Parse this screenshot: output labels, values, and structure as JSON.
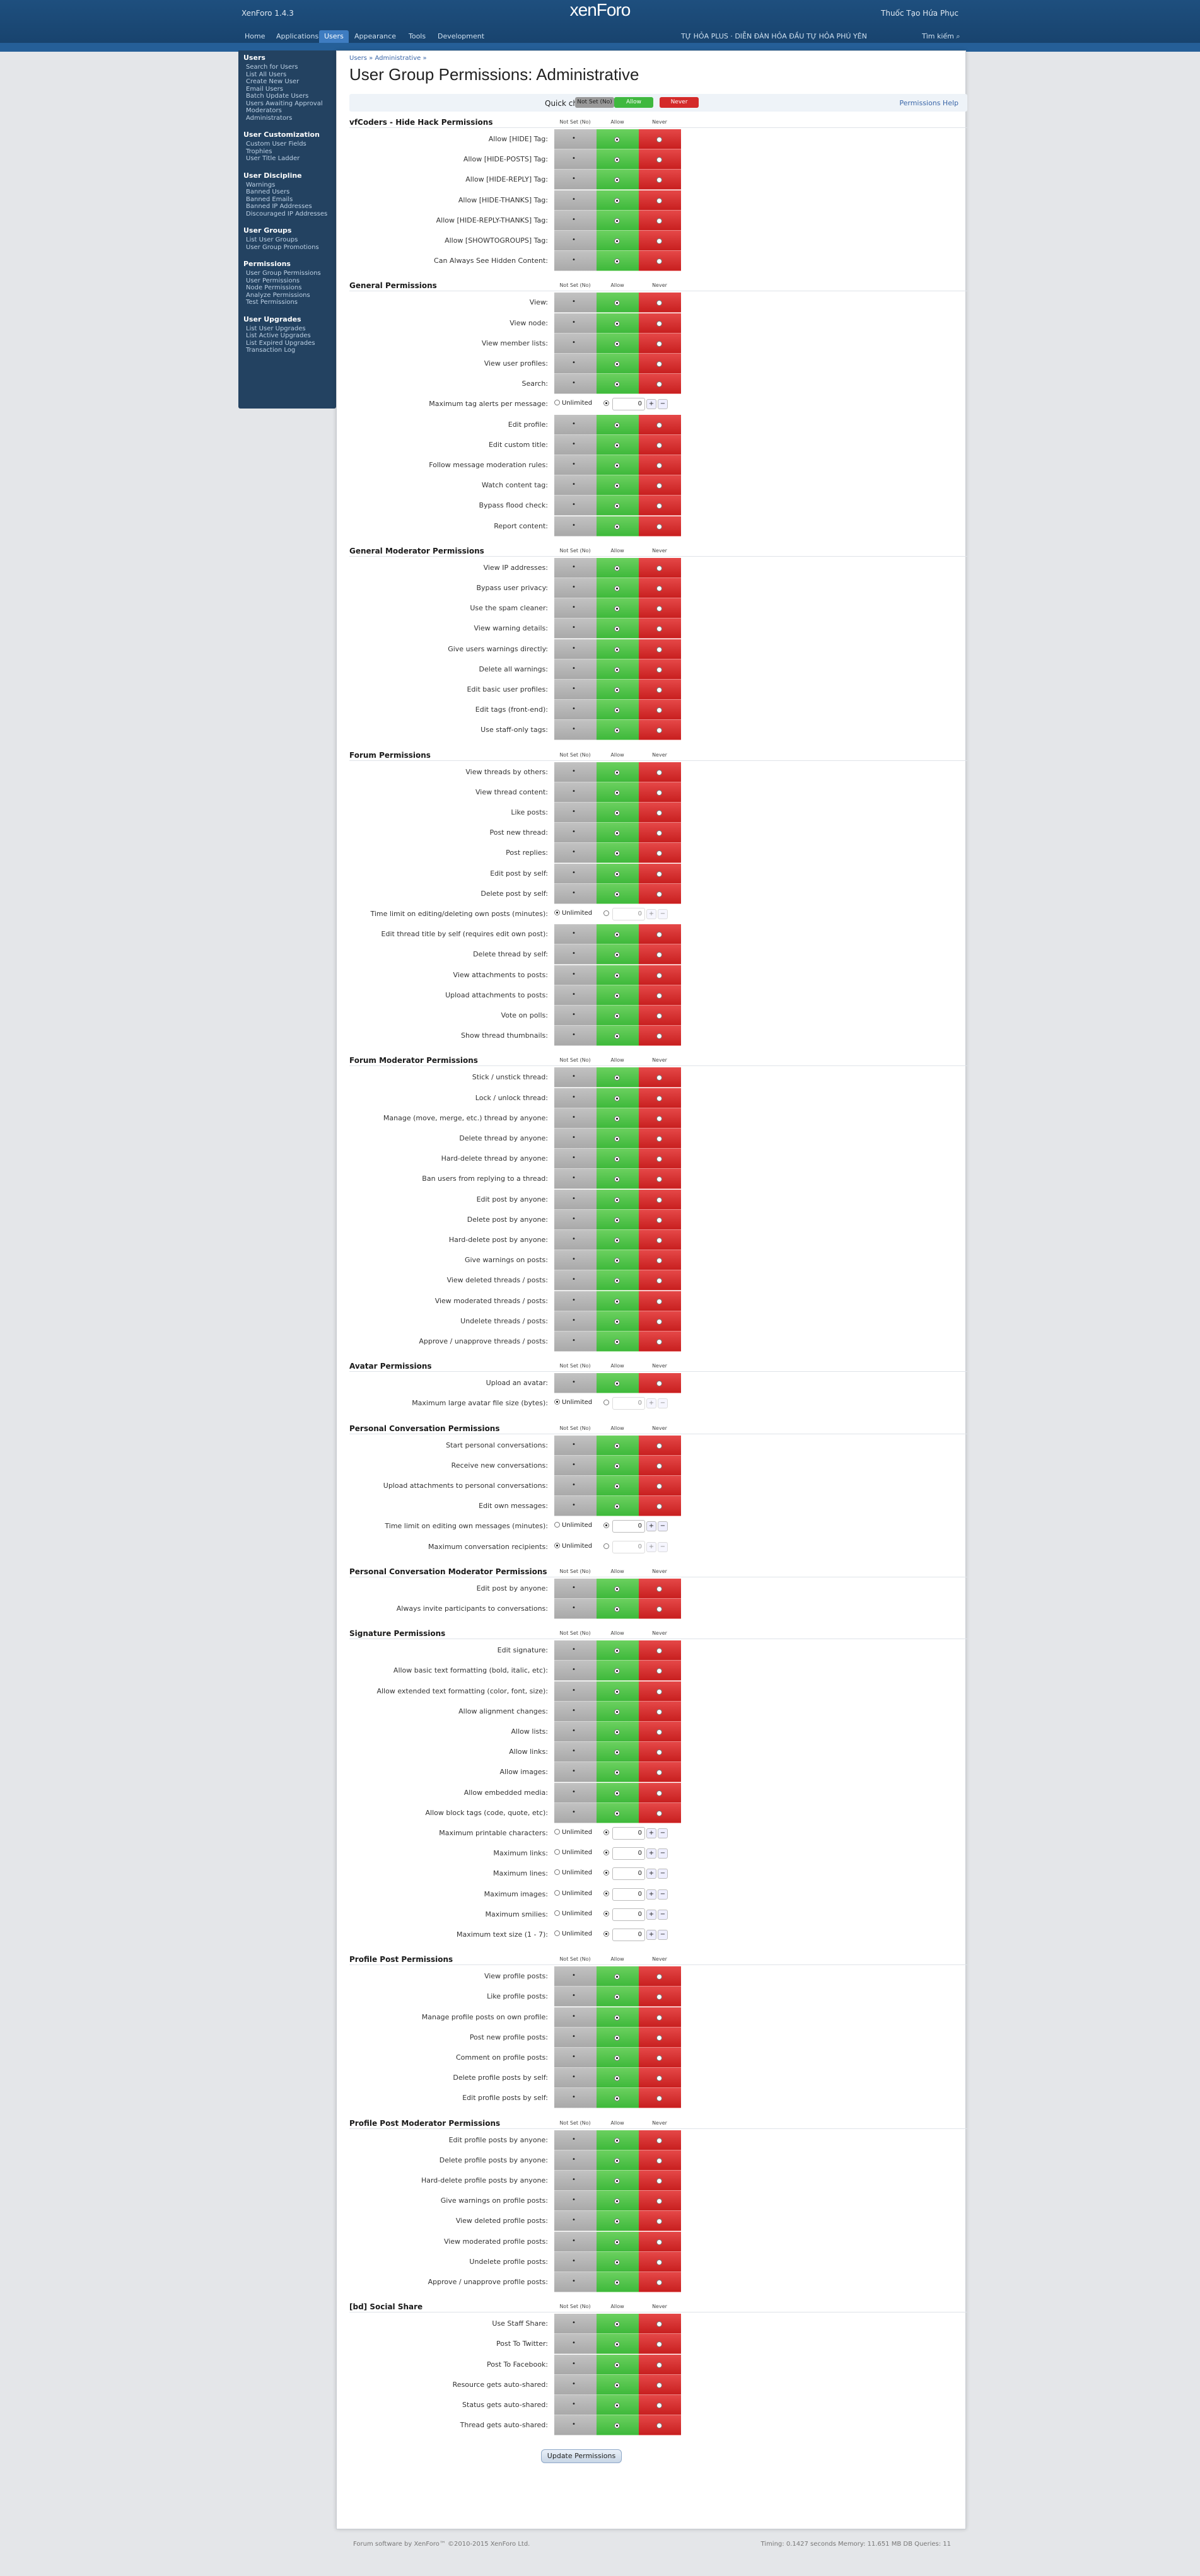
{
  "header": {
    "site": "XenForo 1.4.3",
    "user": "Thuốc Tạo Hứa Phục",
    "logo": "xenForo",
    "search": "Tìm kiếm",
    "extra_links": "TỰ HỎA PLUS · DIỄN ĐÀN HỎA ĐẦU TỰ HỎA PHÚ YÊN"
  },
  "tabs": [
    "Home",
    "Applications",
    "Users",
    "Appearance",
    "Tools",
    "Development"
  ],
  "sidebar": [
    {
      "h": "Users",
      "items": [
        "Search for Users",
        "List All Users",
        "Create New User",
        "Email Users",
        "Batch Update Users",
        "Users Awaiting Approval",
        "Moderators",
        "Administrators"
      ]
    },
    {
      "h": "User Customization",
      "items": [
        "Custom User Fields",
        "Trophies",
        "User Title Ladder"
      ]
    },
    {
      "h": "User Discipline",
      "items": [
        "Warnings",
        "Banned Users",
        "Banned Emails",
        "Banned IP Addresses",
        "Discouraged IP Addresses"
      ]
    },
    {
      "h": "User Groups",
      "items": [
        "List User Groups",
        "User Group Promotions"
      ]
    },
    {
      "h": "Permissions",
      "items": [
        "User Group Permissions",
        "User Permissions",
        "Node Permissions",
        "Analyze Permissions",
        "Test Permissions"
      ]
    },
    {
      "h": "User Upgrades",
      "items": [
        "List User Upgrades",
        "List Active Upgrades",
        "List Expired Upgrades",
        "Transaction Log"
      ]
    }
  ],
  "breadcrumb": "Users » Administrative »",
  "page_title": "User Group Permissions: Administrative",
  "quick": {
    "label": "Quick check all:",
    "not_set": "Not Set (No)",
    "allow": "Allow",
    "never": "Never",
    "help": "Permissions Help"
  },
  "col": {
    "not_set": "Not Set (No)",
    "allow": "Allow",
    "never": "Never"
  },
  "unlimited": "Unlimited",
  "sections": [
    {
      "title": "vfCoders - Hide Hack Permissions",
      "rows": [
        {
          "l": "Allow [HIDE] Tag:",
          "v": "a"
        },
        {
          "l": "Allow [HIDE-POSTS] Tag:",
          "v": "a"
        },
        {
          "l": "Allow [HIDE-REPLY] Tag:",
          "v": "a"
        },
        {
          "l": "Allow [HIDE-THANKS] Tag:",
          "v": "a"
        },
        {
          "l": "Allow [HIDE-REPLY-THANKS] Tag:",
          "v": "a"
        },
        {
          "l": "Allow [SHOWTOGROUPS] Tag:",
          "v": "a"
        },
        {
          "l": "Can Always See Hidden Content:",
          "v": "a"
        }
      ]
    },
    {
      "title": "General Permissions",
      "rows": [
        {
          "l": "View:",
          "v": "a"
        },
        {
          "l": "View node:",
          "v": "a"
        },
        {
          "l": "View member lists:",
          "v": "a"
        },
        {
          "l": "View user profiles:",
          "v": "a"
        },
        {
          "l": "Search:",
          "v": "a"
        },
        {
          "l": "Maximum tag alerts per message:",
          "num": true,
          "unl": false,
          "val": "0"
        },
        {
          "l": "Edit profile:",
          "v": "a"
        },
        {
          "l": "Edit custom title:",
          "v": "a"
        },
        {
          "l": "Follow message moderation rules:",
          "v": "a"
        },
        {
          "l": "Watch content tag:",
          "v": "a"
        },
        {
          "l": "Bypass flood check:",
          "v": "a"
        },
        {
          "l": "Report content:",
          "v": "a"
        }
      ]
    },
    {
      "title": "General Moderator Permissions",
      "rows": [
        {
          "l": "View IP addresses:",
          "v": "a"
        },
        {
          "l": "Bypass user privacy:",
          "v": "a"
        },
        {
          "l": "Use the spam cleaner:",
          "v": "a"
        },
        {
          "l": "View warning details:",
          "v": "a"
        },
        {
          "l": "Give users warnings directly:",
          "v": "a"
        },
        {
          "l": "Delete all warnings:",
          "v": "a"
        },
        {
          "l": "Edit basic user profiles:",
          "v": "a"
        },
        {
          "l": "Edit tags (front-end):",
          "v": "a"
        },
        {
          "l": "Use staff-only tags:",
          "v": "a"
        }
      ]
    },
    {
      "title": "Forum Permissions",
      "rows": [
        {
          "l": "View threads by others:",
          "v": "a"
        },
        {
          "l": "View thread content:",
          "v": "a"
        },
        {
          "l": "Like posts:",
          "v": "a"
        },
        {
          "l": "Post new thread:",
          "v": "a"
        },
        {
          "l": "Post replies:",
          "v": "a"
        },
        {
          "l": "Edit post by self:",
          "v": "a"
        },
        {
          "l": "Delete post by self:",
          "v": "a"
        },
        {
          "l": "Time limit on editing/deleting own posts (minutes):",
          "num": true,
          "unl": true,
          "val": "0"
        },
        {
          "l": "Edit thread title by self (requires edit own post):",
          "v": "a"
        },
        {
          "l": "Delete thread by self:",
          "v": "a"
        },
        {
          "l": "View attachments to posts:",
          "v": "a"
        },
        {
          "l": "Upload attachments to posts:",
          "v": "a"
        },
        {
          "l": "Vote on polls:",
          "v": "a"
        },
        {
          "l": "Show thread thumbnails:",
          "v": "a"
        }
      ]
    },
    {
      "title": "Forum Moderator Permissions",
      "rows": [
        {
          "l": "Stick / unstick thread:",
          "v": "a"
        },
        {
          "l": "Lock / unlock thread:",
          "v": "a"
        },
        {
          "l": "Manage (move, merge, etc.) thread by anyone:",
          "v": "a"
        },
        {
          "l": "Delete thread by anyone:",
          "v": "a"
        },
        {
          "l": "Hard-delete thread by anyone:",
          "v": "a"
        },
        {
          "l": "Ban users from replying to a thread:",
          "v": "a"
        },
        {
          "l": "Edit post by anyone:",
          "v": "a"
        },
        {
          "l": "Delete post by anyone:",
          "v": "a"
        },
        {
          "l": "Hard-delete post by anyone:",
          "v": "a"
        },
        {
          "l": "Give warnings on posts:",
          "v": "a"
        },
        {
          "l": "View deleted threads / posts:",
          "v": "a"
        },
        {
          "l": "View moderated threads / posts:",
          "v": "a"
        },
        {
          "l": "Undelete threads / posts:",
          "v": "a"
        },
        {
          "l": "Approve / unapprove threads / posts:",
          "v": "a"
        }
      ]
    },
    {
      "title": "Avatar Permissions",
      "rows": [
        {
          "l": "Upload an avatar:",
          "v": "a"
        },
        {
          "l": "Maximum large avatar file size (bytes):",
          "num": true,
          "unl": true,
          "val": "0"
        }
      ]
    },
    {
      "title": "Personal Conversation Permissions",
      "rows": [
        {
          "l": "Start personal conversations:",
          "v": "a"
        },
        {
          "l": "Receive new conversations:",
          "v": "a"
        },
        {
          "l": "Upload attachments to personal conversations:",
          "v": "a"
        },
        {
          "l": "Edit own messages:",
          "v": "a"
        },
        {
          "l": "Time limit on editing own messages (minutes):",
          "num": true,
          "unl": false,
          "val": "0"
        },
        {
          "l": "Maximum conversation recipients:",
          "num": true,
          "unl": true,
          "val": "0"
        }
      ]
    },
    {
      "title": "Personal Conversation Moderator Permissions",
      "rows": [
        {
          "l": "Edit post by anyone:",
          "v": "a"
        },
        {
          "l": "Always invite participants to conversations:",
          "v": "a"
        }
      ]
    },
    {
      "title": "Signature Permissions",
      "rows": [
        {
          "l": "Edit signature:",
          "v": "a"
        },
        {
          "l": "Allow basic text formatting (bold, italic, etc):",
          "v": "a"
        },
        {
          "l": "Allow extended text formatting (color, font, size):",
          "v": "a"
        },
        {
          "l": "Allow alignment changes:",
          "v": "a"
        },
        {
          "l": "Allow lists:",
          "v": "a"
        },
        {
          "l": "Allow links:",
          "v": "a"
        },
        {
          "l": "Allow images:",
          "v": "a"
        },
        {
          "l": "Allow embedded media:",
          "v": "a"
        },
        {
          "l": "Allow block tags (code, quote, etc):",
          "v": "a"
        },
        {
          "l": "Maximum printable characters:",
          "num": true,
          "unl": false,
          "val": "0"
        },
        {
          "l": "Maximum links:",
          "num": true,
          "unl": false,
          "val": "0"
        },
        {
          "l": "Maximum lines:",
          "num": true,
          "unl": false,
          "val": "0"
        },
        {
          "l": "Maximum images:",
          "num": true,
          "unl": false,
          "val": "0"
        },
        {
          "l": "Maximum smilies:",
          "num": true,
          "unl": false,
          "val": "0"
        },
        {
          "l": "Maximum text size (1 - 7):",
          "num": true,
          "unl": false,
          "val": "0"
        }
      ]
    },
    {
      "title": "Profile Post Permissions",
      "rows": [
        {
          "l": "View profile posts:",
          "v": "a"
        },
        {
          "l": "Like profile posts:",
          "v": "a"
        },
        {
          "l": "Manage profile posts on own profile:",
          "v": "a"
        },
        {
          "l": "Post new profile posts:",
          "v": "a"
        },
        {
          "l": "Comment on profile posts:",
          "v": "a"
        },
        {
          "l": "Delete profile posts by self:",
          "v": "a"
        },
        {
          "l": "Edit profile posts by self:",
          "v": "a"
        }
      ]
    },
    {
      "title": "Profile Post Moderator Permissions",
      "rows": [
        {
          "l": "Edit profile posts by anyone:",
          "v": "a"
        },
        {
          "l": "Delete profile posts by anyone:",
          "v": "a"
        },
        {
          "l": "Hard-delete profile posts by anyone:",
          "v": "a"
        },
        {
          "l": "Give warnings on profile posts:",
          "v": "a"
        },
        {
          "l": "View deleted profile posts:",
          "v": "a"
        },
        {
          "l": "View moderated profile posts:",
          "v": "a"
        },
        {
          "l": "Undelete profile posts:",
          "v": "a"
        },
        {
          "l": "Approve / unapprove profile posts:",
          "v": "a"
        }
      ]
    },
    {
      "title": "[bd] Social Share",
      "rows": [
        {
          "l": "Use Staff Share:",
          "v": "a"
        },
        {
          "l": "Post To Twitter:",
          "v": "a"
        },
        {
          "l": "Post To Facebook:",
          "v": "a"
        },
        {
          "l": "Resource gets auto-shared:",
          "v": "a"
        },
        {
          "l": "Status gets auto-shared:",
          "v": "a"
        },
        {
          "l": "Thread gets auto-shared:",
          "v": "a"
        }
      ]
    }
  ],
  "submit": "Update Permissions",
  "footer": {
    "left": "Forum software by XenForo™ ©2010-2015 XenForo Ltd.",
    "right": "Timing: 0.1427 seconds Memory: 11.651 MB DB Queries: 11"
  },
  "colors": {
    "header": "#1e4f7e",
    "allow": "#3eb93b",
    "never": "#c81f1f",
    "not_set": "#a9a9a9",
    "sidebar": "#234261"
  }
}
